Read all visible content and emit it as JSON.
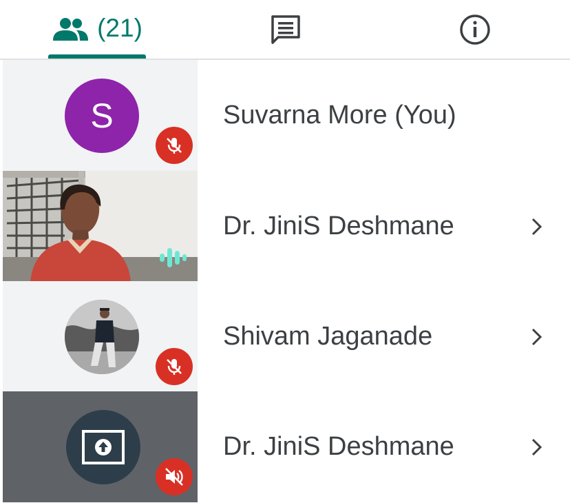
{
  "tabs": {
    "people": {
      "icon": "people-icon",
      "count": "(21)",
      "selected": true
    },
    "chat": {
      "icon": "chat-icon"
    },
    "info": {
      "icon": "info-icon"
    }
  },
  "participants": [
    {
      "avatar_letter": "S",
      "avatar_color": "#8e24aa",
      "name": "Suvarna More (You)",
      "status": "mic-off-icon"
    },
    {
      "name": "Dr. JiniS Deshmane",
      "status": "speaking-icon",
      "has_video": true
    },
    {
      "name": "Shivam Jaganade",
      "status": "mic-off-icon"
    },
    {
      "name": "Dr. JiniS Deshmane",
      "status": "volume-off-icon",
      "tile": "present-screen-icon"
    }
  ],
  "colors": {
    "accent": "#00796b",
    "mute_badge": "#d93025",
    "speaking": "#6ee7d2"
  }
}
